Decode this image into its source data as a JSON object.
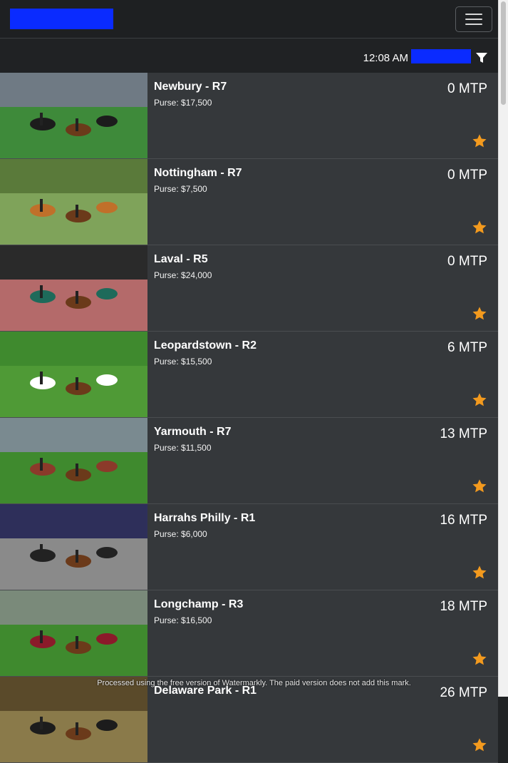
{
  "navbar": {
    "menu_label": "Toggle navigation"
  },
  "subbar": {
    "time": "12:08 AM"
  },
  "icons": {
    "filter": "filter-icon",
    "favorite": "star-icon",
    "menu": "hamburger-icon"
  },
  "colors": {
    "star": "#f39a1e",
    "redaction": "#0a2bff",
    "card": "#35383b"
  },
  "races": [
    {
      "name": "Newbury - R7",
      "purse": "Purse: $17,500",
      "mtp": "0 MTP"
    },
    {
      "name": "Nottingham - R7",
      "purse": "Purse: $7,500",
      "mtp": "0 MTP"
    },
    {
      "name": "Laval - R5",
      "purse": "Purse: $24,000",
      "mtp": "0 MTP"
    },
    {
      "name": "Leopardstown - R2",
      "purse": "Purse: $15,500",
      "mtp": "6 MTP"
    },
    {
      "name": "Yarmouth - R7",
      "purse": "Purse: $11,500",
      "mtp": "13 MTP"
    },
    {
      "name": "Harrahs Philly - R1",
      "purse": "Purse: $6,000",
      "mtp": "16 MTP"
    },
    {
      "name": "Longchamp - R3",
      "purse": "Purse: $16,500",
      "mtp": "18 MTP"
    },
    {
      "name": "Delaware Park - R1",
      "purse": "",
      "mtp": "26 MTP"
    }
  ],
  "footer_note": "Processed using the free version of Watermarkly. The paid version does not add this mark."
}
